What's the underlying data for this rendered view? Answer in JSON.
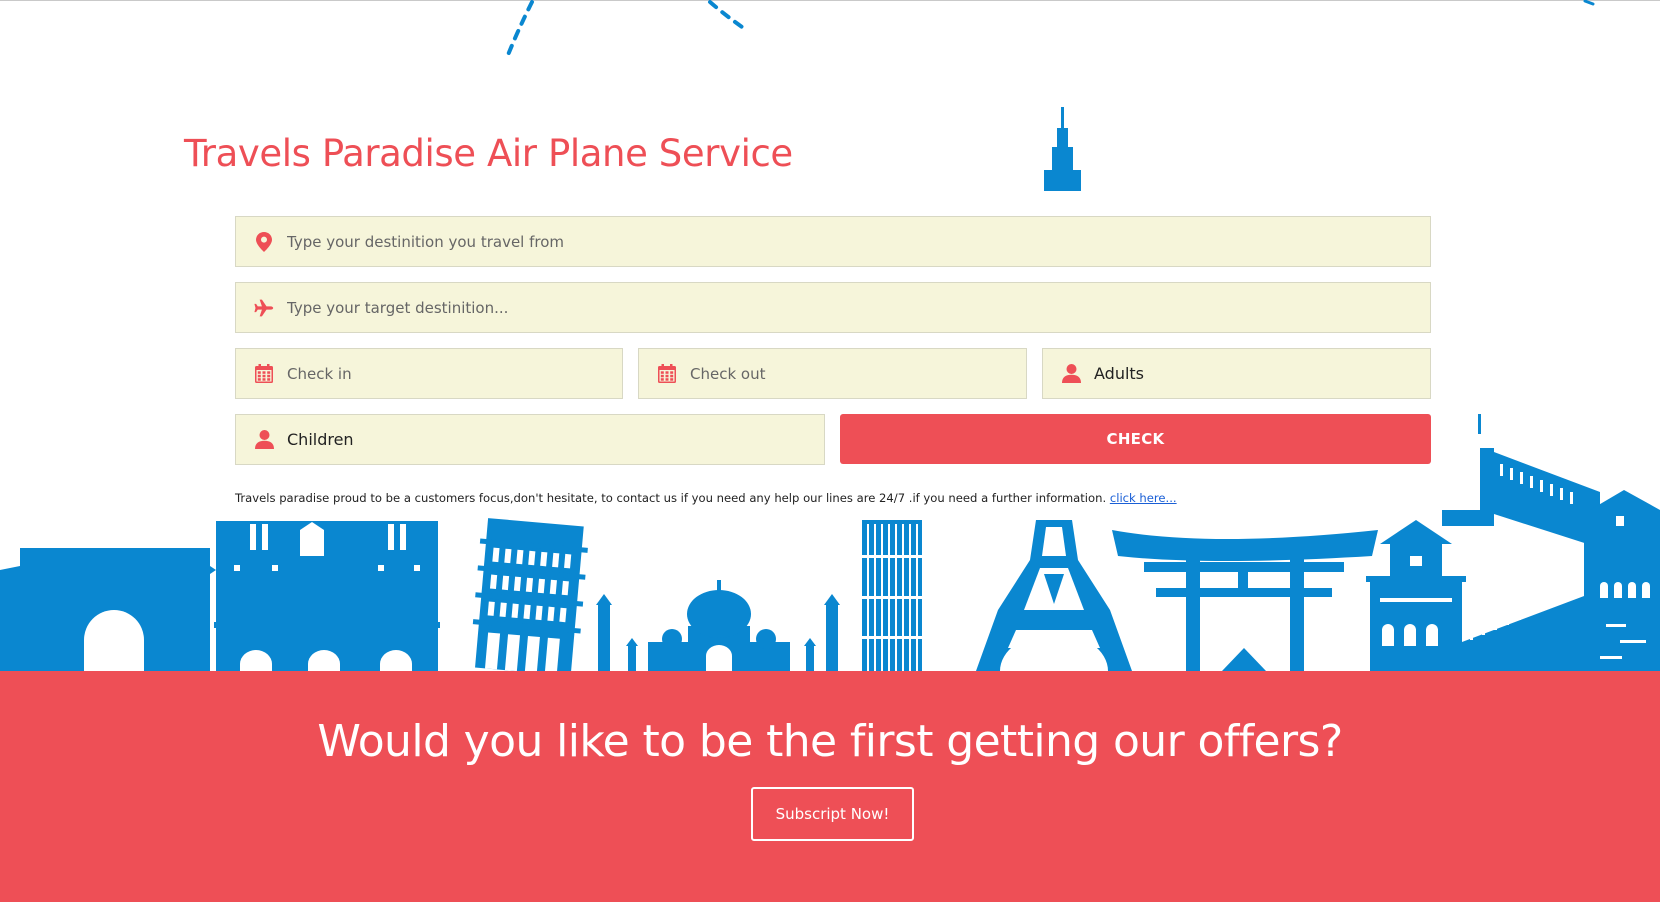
{
  "theme": {
    "accent": "#ee4f56",
    "field_bg": "#f6f5da",
    "skyline": "#0a87d0",
    "link": "#1a5fd6"
  },
  "hero": {
    "title": "Travels Paradise Air Plane Service"
  },
  "form": {
    "from": {
      "placeholder": "Type your destinition you travel from",
      "icon": "map-pin-icon"
    },
    "to": {
      "placeholder": "Type your target destinition...",
      "icon": "airplane-icon"
    },
    "check_in": {
      "placeholder": "Check in",
      "icon": "calendar-icon"
    },
    "check_out": {
      "placeholder": "Check out",
      "icon": "calendar-icon"
    },
    "adults": {
      "value": "Adults",
      "icon": "person-icon"
    },
    "children": {
      "value": "Children",
      "icon": "person-icon"
    },
    "check_label": "CHECK"
  },
  "info": {
    "text": "Travels paradise proud to be a customers focus,don't hesitate, to contact us if you need any help our lines are 24/7 .if you need a further information. ",
    "link_text": "click here..."
  },
  "banner": {
    "title": "Would you like to be the first getting our offers?",
    "button_label": "Subscript Now!"
  }
}
